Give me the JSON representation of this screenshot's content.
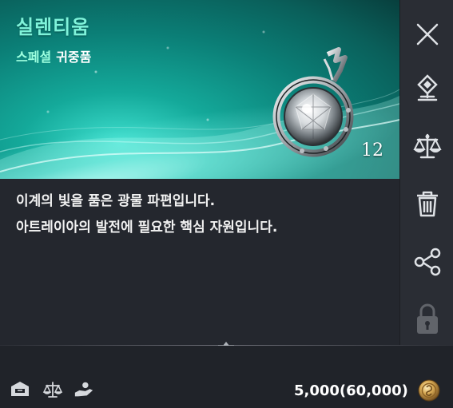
{
  "item": {
    "name": "실렌티움",
    "grade": "스페셜",
    "category": "귀중품",
    "quantity": "12",
    "description": [
      "이계의 빛을 품은 광물 파편입니다.",
      "아트레이아의 발전에 필요한 핵심 자원입니다."
    ]
  },
  "actions": [
    {
      "name": "close",
      "icon": "close-icon"
    },
    {
      "name": "locate",
      "icon": "location-pin-icon"
    },
    {
      "name": "trade",
      "icon": "scale-icon"
    },
    {
      "name": "discard",
      "icon": "trash-icon"
    },
    {
      "name": "share",
      "icon": "share-icon"
    },
    {
      "name": "lock",
      "icon": "lock-icon",
      "disabled": true
    }
  ],
  "footer": {
    "price": "5,000(60,000)",
    "icons": [
      "storage-icon",
      "trade-scale-icon",
      "hand-coin-icon"
    ],
    "currency_icon": "gold-coin-icon"
  },
  "colors": {
    "title": "#7ff3da",
    "grade": "#9dffdf",
    "banner": "#0b7e76",
    "background": "#24272e"
  }
}
